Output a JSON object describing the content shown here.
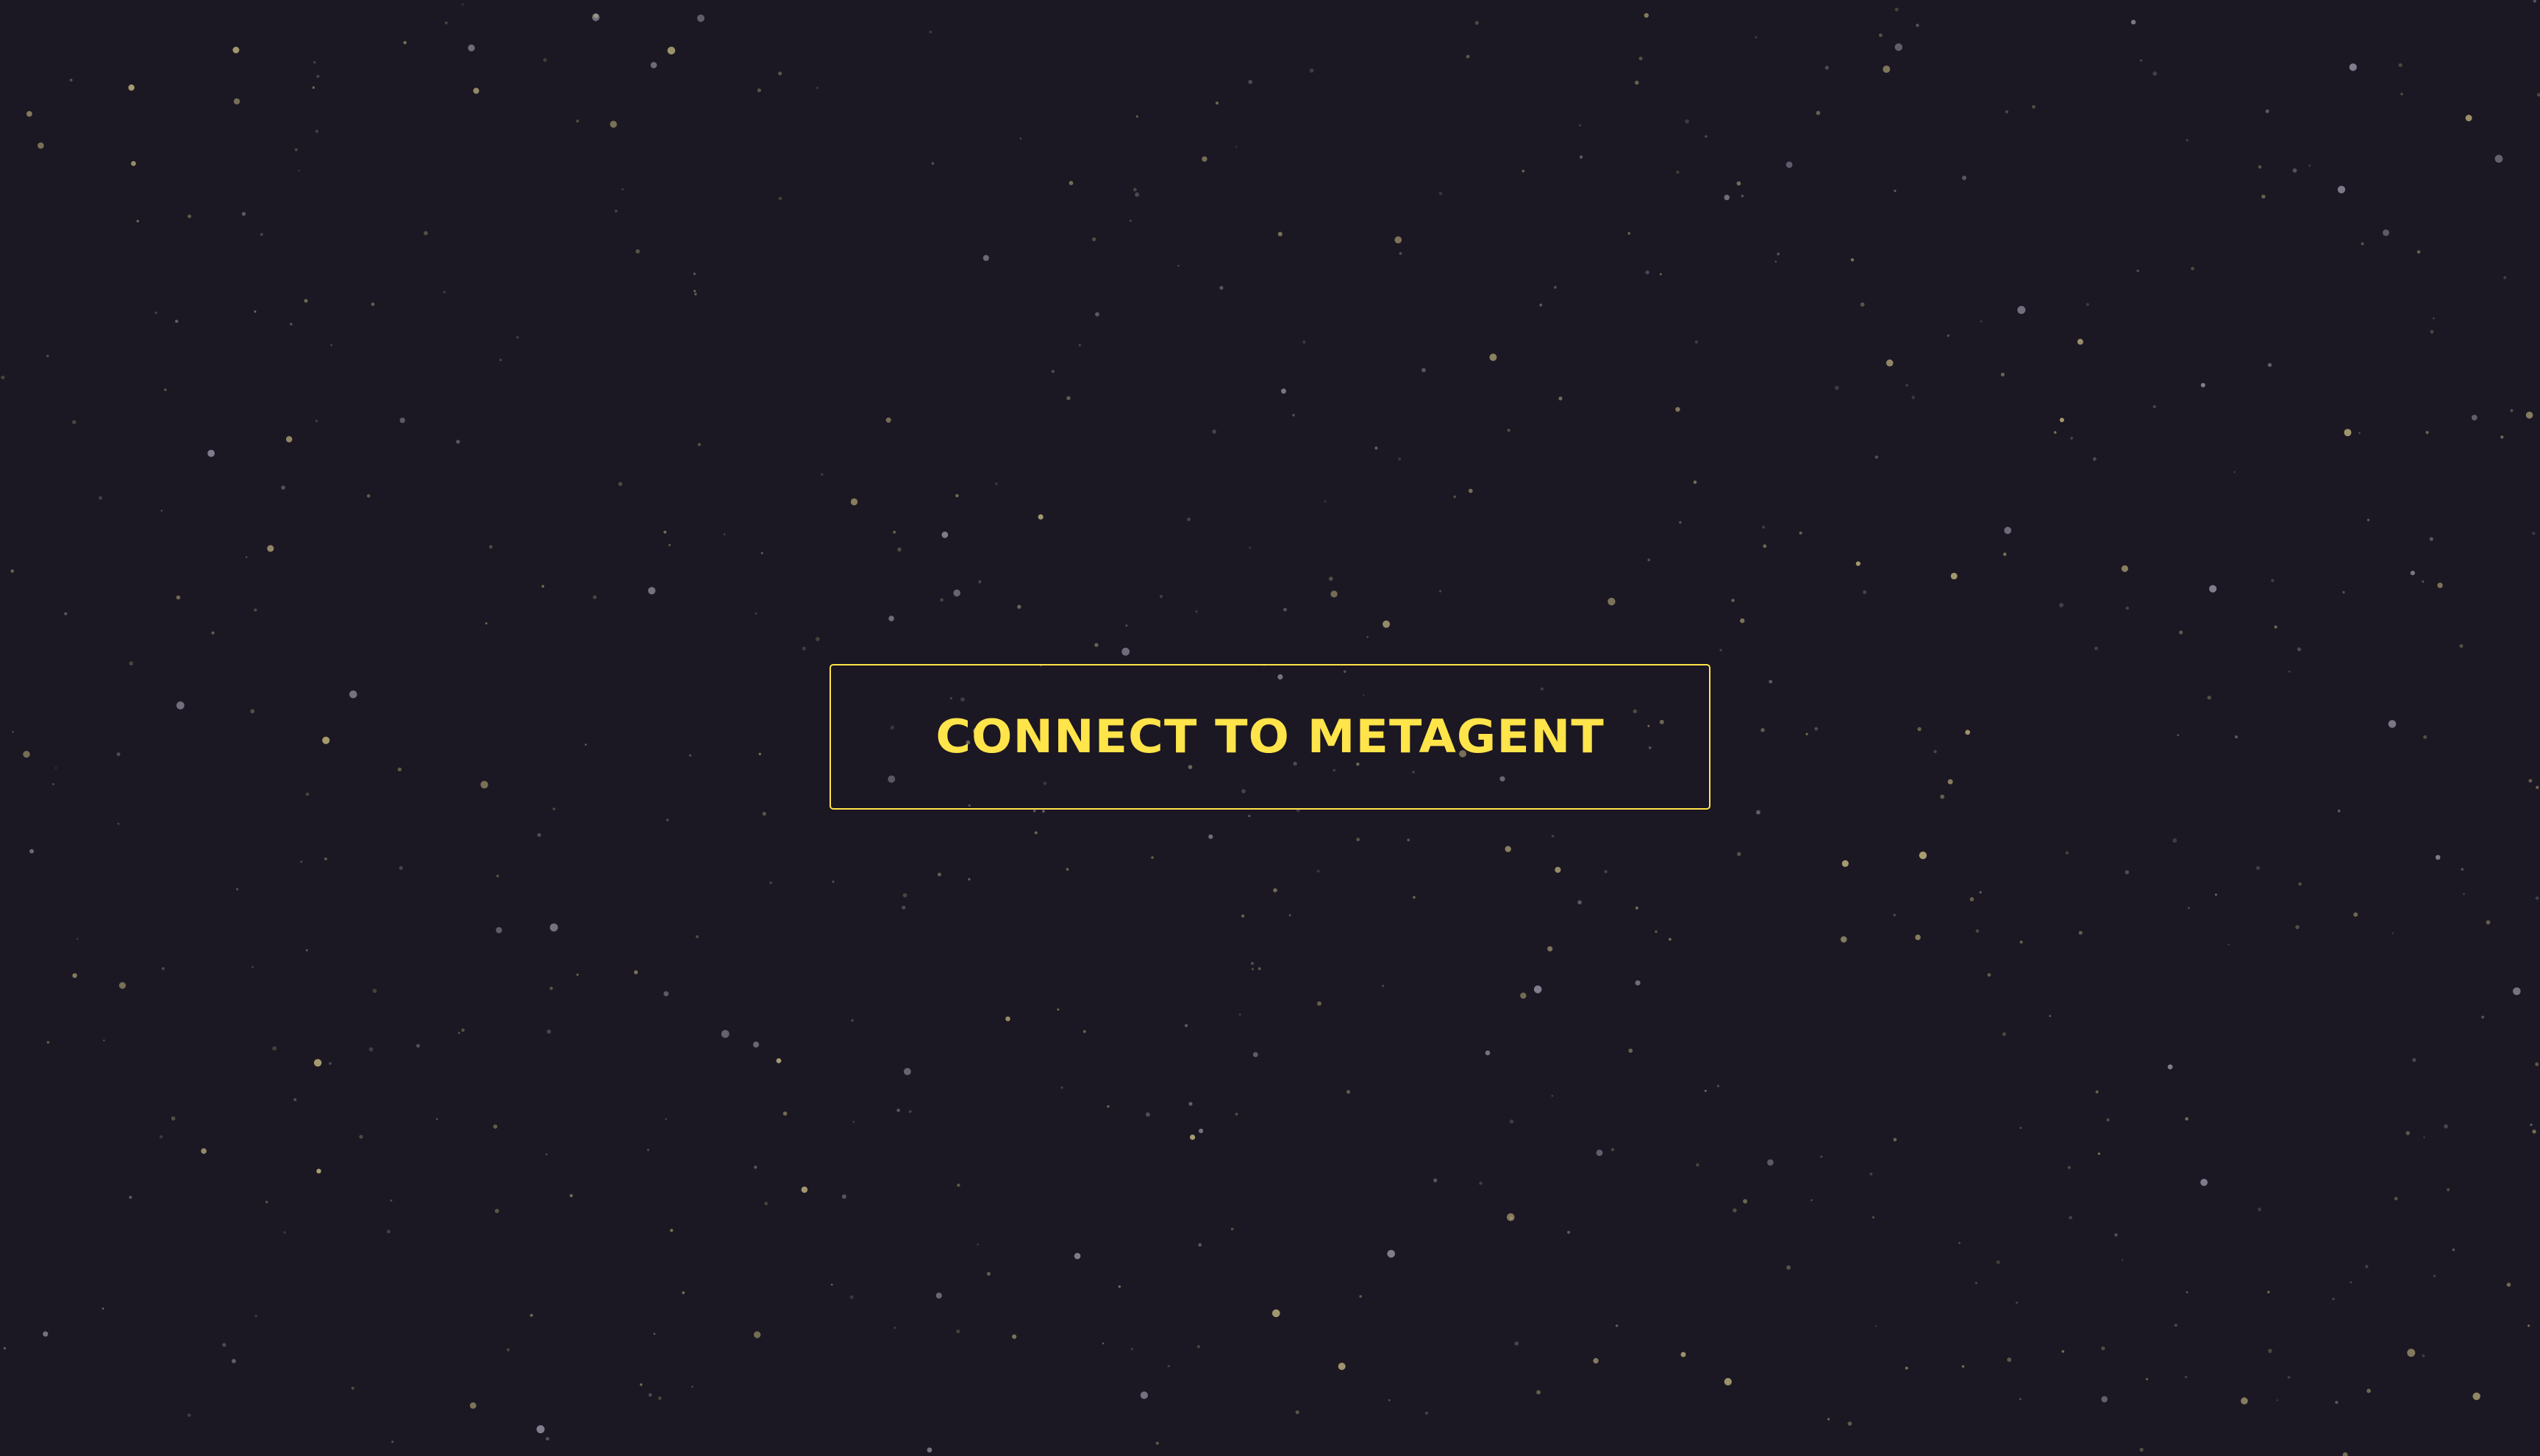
{
  "screen": {
    "background": "#1b1723",
    "decoration": "starfield"
  },
  "connect": {
    "label": "CONNECT TO METAGENT",
    "accent_color": "#ffe44a"
  }
}
